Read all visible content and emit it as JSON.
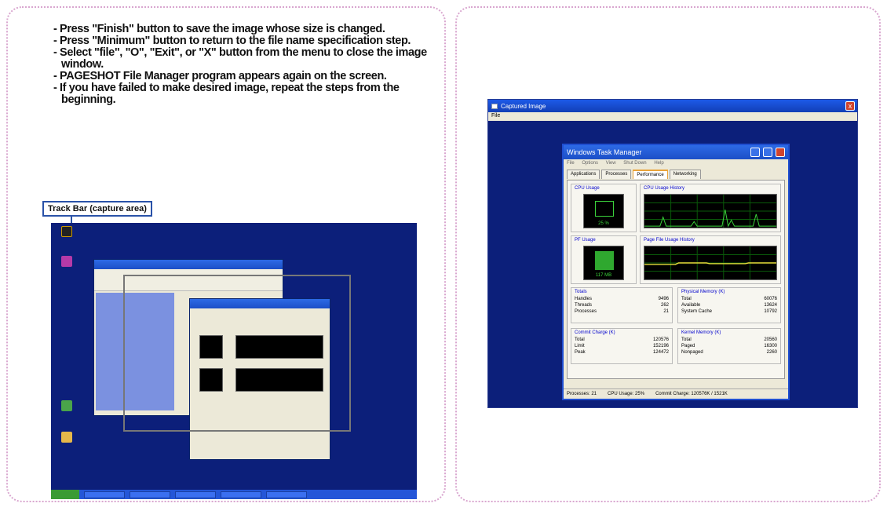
{
  "instructions": [
    "- Press \"Finish\" button to save the image whose size is changed.",
    "- Press \"Minimum\" button to return to the file name specification step.",
    "- Select \"file\", \"O\", \"Exit\", or \"X\" button from the menu to close the image window.",
    "- PAGESHOT File Manager program appears again on the screen.",
    "- If you have failed to make desired image, repeat the steps from the beginning."
  ],
  "track_bar_label": "Track Bar (capture area)",
  "captured_window": {
    "title": "Captured Image",
    "menu": "File",
    "close": "x"
  },
  "task_manager": {
    "title": "Windows Task Manager",
    "menu": [
      "File",
      "Options",
      "View",
      "Shut Down",
      "Help"
    ],
    "tabs": [
      "Applications",
      "Processes",
      "Performance",
      "Networking"
    ],
    "active_tab": "Performance",
    "cpu_usage_label": "CPU Usage",
    "cpu_usage_value": "25 %",
    "cpu_history_label": "CPU Usage History",
    "pf_usage_label": "PF Usage",
    "pf_usage_value": "117 MB",
    "pf_history_label": "Page File Usage History",
    "totals": {
      "label": "Totals",
      "rows": [
        [
          "Handles",
          "9496"
        ],
        [
          "Threads",
          "262"
        ],
        [
          "Processes",
          "21"
        ]
      ]
    },
    "physical_memory": {
      "label": "Physical Memory (K)",
      "rows": [
        [
          "Total",
          "60076"
        ],
        [
          "Available",
          "13624"
        ],
        [
          "System Cache",
          "10792"
        ]
      ]
    },
    "commit_charge": {
      "label": "Commit Charge (K)",
      "rows": [
        [
          "Total",
          "120576"
        ],
        [
          "Limit",
          "152196"
        ],
        [
          "Peak",
          "124472"
        ]
      ]
    },
    "kernel_memory": {
      "label": "Kernel Memory (K)",
      "rows": [
        [
          "Total",
          "20560"
        ],
        [
          "Paged",
          "16300"
        ],
        [
          "Nonpaged",
          "2260"
        ]
      ]
    },
    "status": {
      "processes": "Processes: 21",
      "cpu": "CPU Usage: 25%",
      "commit": "Commit Charge: 120576K / 1521K"
    }
  },
  "colors": {
    "desktop": "#0c1f7a",
    "panel_border": "#d9a6cf",
    "track_border": "#2a52a8",
    "graph_line": "#3bd23b"
  }
}
